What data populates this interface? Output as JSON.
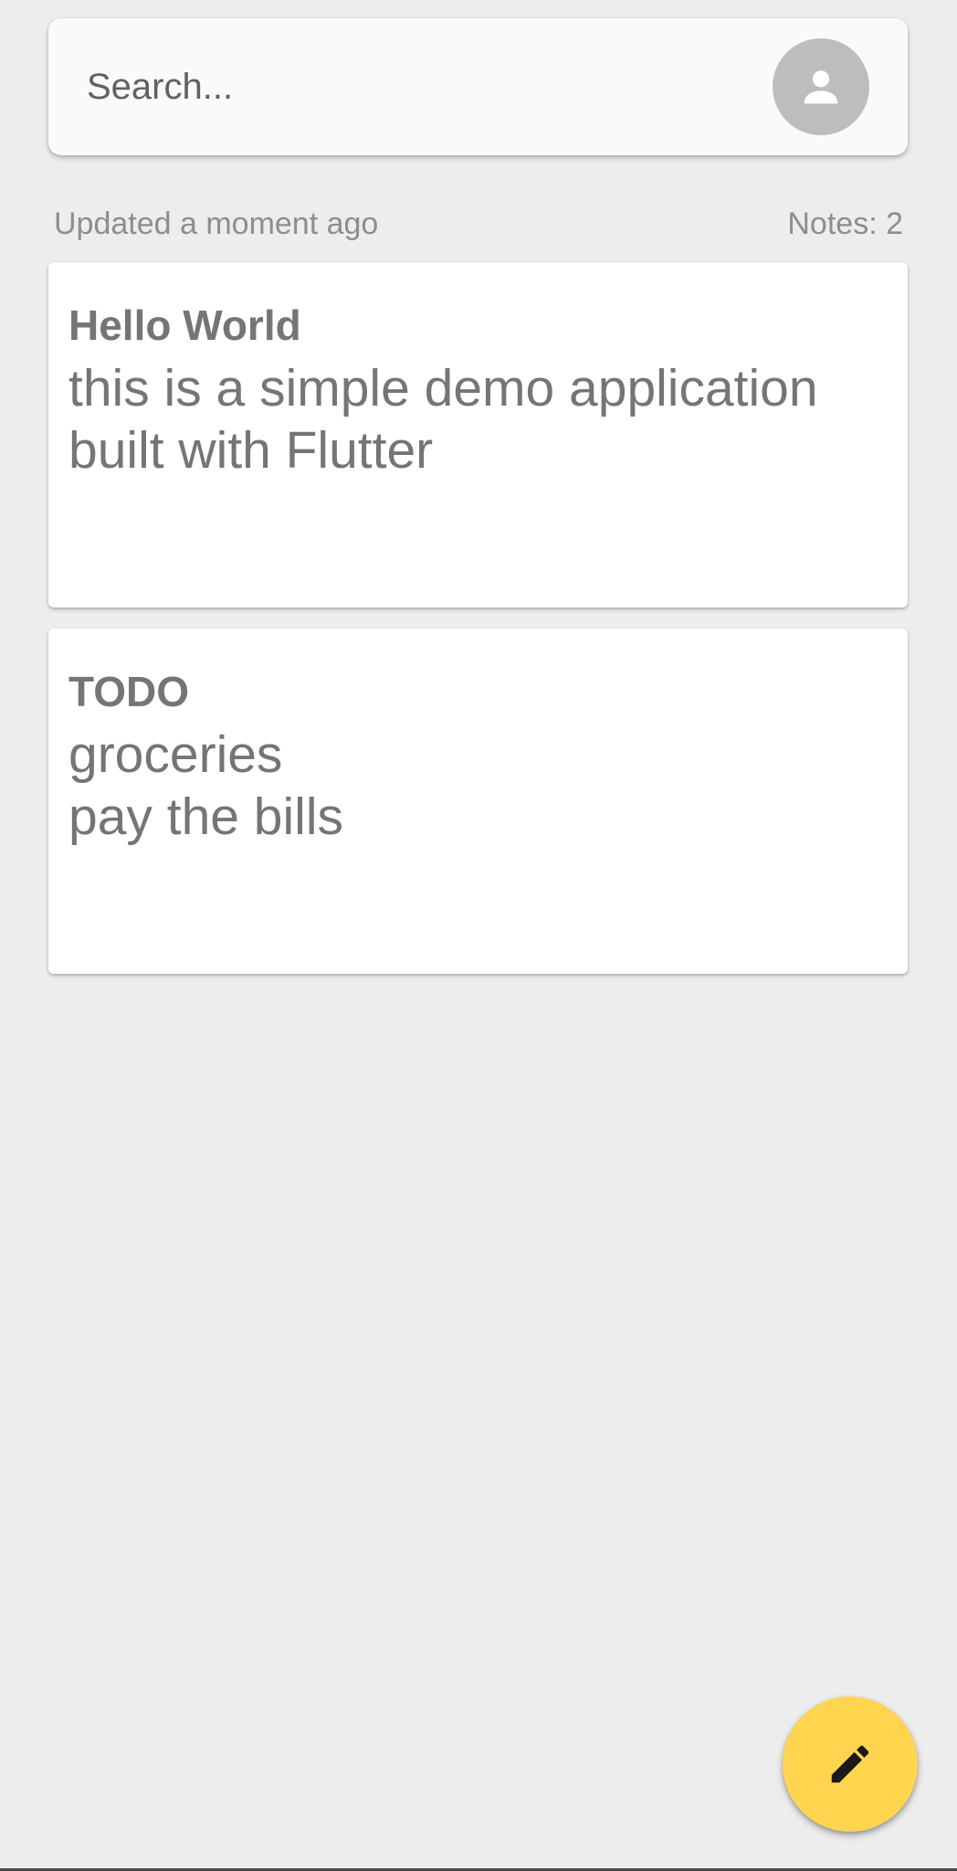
{
  "search": {
    "placeholder": "Search...",
    "avatar_icon": "account-icon"
  },
  "status": {
    "updated": "Updated a moment ago",
    "count": "Notes: 2"
  },
  "notes": [
    {
      "title": "Hello World",
      "body": "this is a simple demo application built with Flutter"
    },
    {
      "title": "TODO",
      "body": "groceries\npay the bills"
    }
  ],
  "fab": {
    "icon": "pencil-icon",
    "color": "#ffd54f"
  },
  "colors": {
    "background": "#ededed",
    "card": "#ffffff",
    "text": "#757575",
    "accent": "#ffd54f"
  }
}
